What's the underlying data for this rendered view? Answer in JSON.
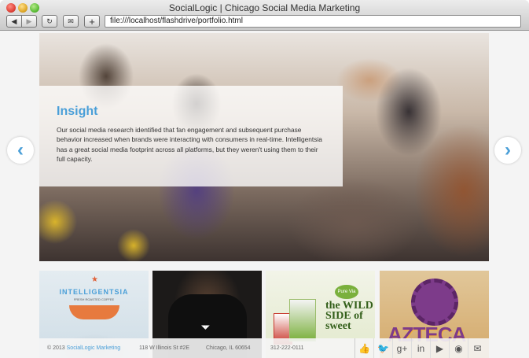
{
  "window": {
    "title": "SocialLogic | Chicago Social Media Marketing",
    "url": "file:///localhost/flashdrive/portfolio.html"
  },
  "toolbar": {
    "back_icon": "◀",
    "forward_icon": "▶",
    "reload_icon": "↻",
    "bookmarks_icon": "✉",
    "add_icon": "+"
  },
  "hero": {
    "title": "Insight",
    "body": "Our social media research identified that fan engagement and subsequent purchase behavior increased when brands were interacting with consumers in real-time. Intelligentsia has a great social media footprint across all platforms, but they weren't using them to their full capacity.",
    "prev_icon": "‹",
    "next_icon": "›"
  },
  "thumbs": {
    "intelligentsia": {
      "name": "INTELLIGENTSIA",
      "sub": "FRESH ROASTED COFFEE"
    },
    "purevia": {
      "badge": "Pure Via",
      "tagline": "the WILD SIDE of sweet"
    },
    "azteca": {
      "name": "AZTECA"
    }
  },
  "footer": {
    "copyright": "© 2013",
    "company": "SocialLogic Marketing",
    "address": "118 W Illinois St #2E",
    "city": "Chicago, IL 60654",
    "phone": "312-222-0111",
    "social": [
      "👍",
      "🐦",
      "g+",
      "in",
      "▶",
      "◉",
      "✉"
    ]
  },
  "colors": {
    "accent": "#4a9fd8"
  }
}
